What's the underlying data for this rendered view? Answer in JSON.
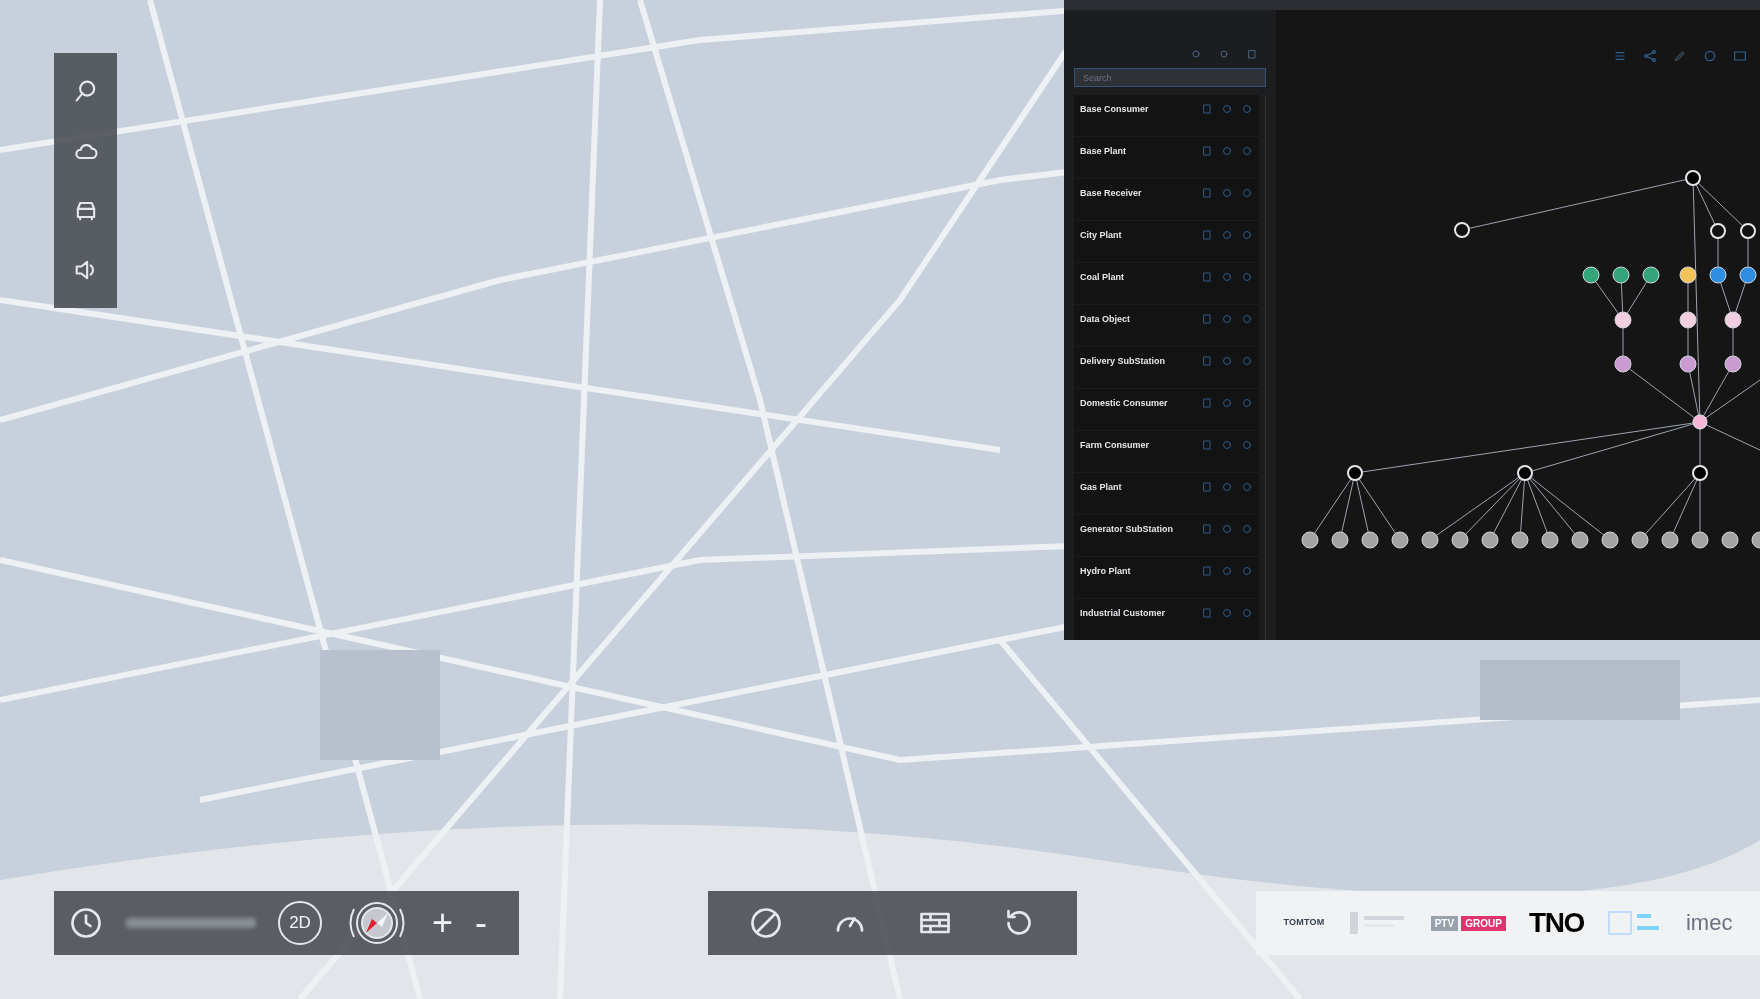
{
  "panel": {
    "search": {
      "placeholder": "Search"
    },
    "items": [
      {
        "title": "Base Consumer"
      },
      {
        "title": "Base Plant"
      },
      {
        "title": "Base Receiver"
      },
      {
        "title": "City Plant"
      },
      {
        "title": "Coal Plant"
      },
      {
        "title": "Data Object"
      },
      {
        "title": "Delivery SubStation"
      },
      {
        "title": "Domestic Consumer"
      },
      {
        "title": "Farm Consumer"
      },
      {
        "title": "Gas Plant"
      },
      {
        "title": "Generator SubStation"
      },
      {
        "title": "Hydro Plant"
      },
      {
        "title": "Industrial Customer"
      }
    ]
  },
  "map_controls": {
    "mode_button": "2D",
    "zoom_in": "+",
    "zoom_out": "-"
  },
  "logos": [
    {
      "kind": "tomtom",
      "text": "TOMTOM"
    },
    {
      "kind": "badge",
      "text": "PTV"
    },
    {
      "kind": "pink",
      "text": "GROUP"
    },
    {
      "kind": "bold",
      "text": "TNO"
    },
    {
      "kind": "thin",
      "text": "imec"
    }
  ]
}
